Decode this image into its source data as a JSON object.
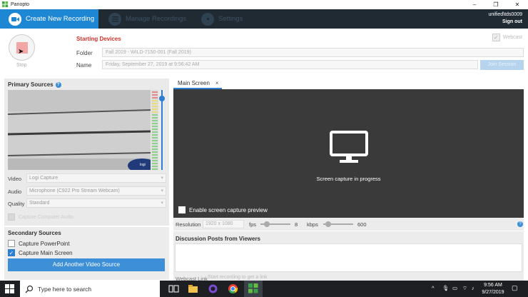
{
  "window": {
    "app_title": "Panopto",
    "controls": [
      "–",
      "❐",
      "✕"
    ]
  },
  "nav": {
    "tabs": [
      {
        "label": "Create New Recording",
        "icon": "video-camera-icon",
        "active": true
      },
      {
        "label": "Manage Recordings",
        "icon": "list-icon",
        "active": false
      },
      {
        "label": "Settings",
        "icon": "gear-icon",
        "active": false
      }
    ],
    "user": "unified\\tds0009",
    "sign_out": "Sign out"
  },
  "recording": {
    "stop_label": "Stop",
    "starting_devices": "Starting Devices",
    "webcast_label": "Webcast",
    "folder_label": "Folder",
    "folder_value": "Fall 2019 - WILD-7150-001 (Fall 2019)",
    "name_label": "Name",
    "name_value": "Friday, September 27, 2019 at 9:56:42 AM",
    "set_session": "Join Session"
  },
  "primary_sources": {
    "title": "Primary Sources",
    "video_label": "Video",
    "video_value": "Logi Capture",
    "audio_label": "Audio",
    "audio_value": "Microphone (C922 Pro Stream Webcam)",
    "quality_label": "Quality",
    "quality_value": "Standard",
    "computer_audio": "Capture Computer Audio",
    "webcam_brand": "logi"
  },
  "secondary_sources": {
    "title": "Secondary Sources",
    "items": [
      {
        "label": "Capture PowerPoint",
        "checked": false
      },
      {
        "label": "Capture Main Screen",
        "checked": true
      }
    ],
    "add_button": "Add Another Video Source"
  },
  "main_screen": {
    "tab_label": "Main Screen",
    "tab_close": "×",
    "status": "Screen capture in progress",
    "enable_preview": "Enable screen capture preview",
    "resolution_label": "Resolution",
    "resolution_value": "1920 x 1080",
    "fps_label": "fps",
    "fps_value": "8",
    "kbps_label": "kbps",
    "kbps_value": "600"
  },
  "discussion": {
    "title": "Discussion Posts from Viewers",
    "webcast_link_label": "Webcast Link",
    "webcast_link_placeholder": "Start recording to get a link"
  },
  "taskbar": {
    "search_placeholder": "Type here to search",
    "time": "9:56 AM",
    "date": "9/27/2019"
  },
  "colors": {
    "nav_bg": "#202a33",
    "accent": "#1e87d4",
    "screen_bg": "#3a3a3a",
    "starting_devices": "#d9302a"
  }
}
